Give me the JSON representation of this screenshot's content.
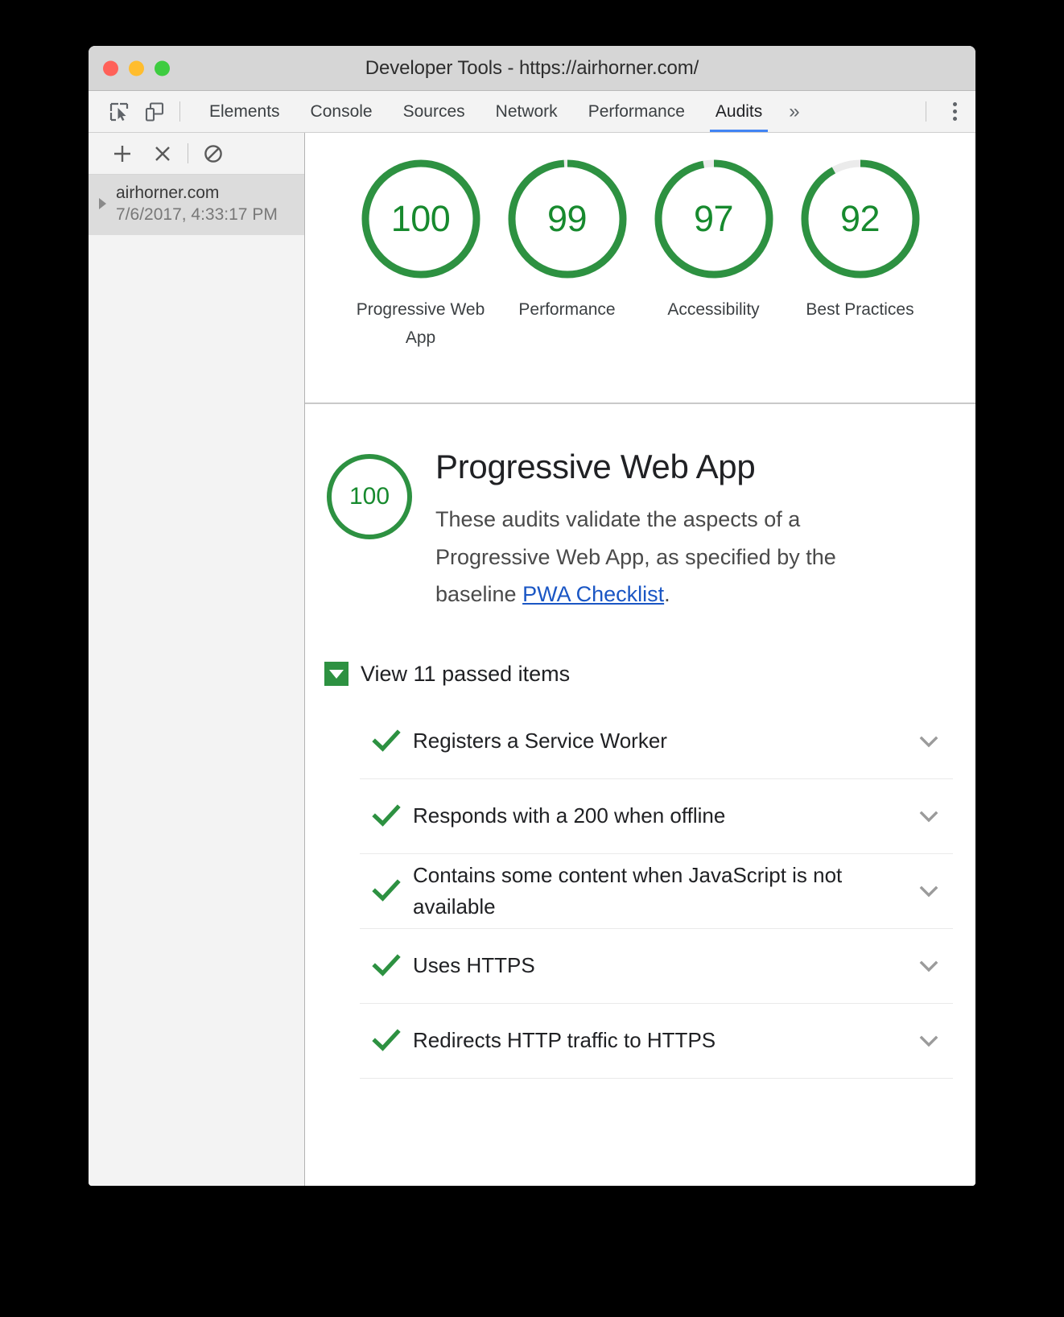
{
  "window": {
    "title": "Developer Tools - https://airhorner.com/",
    "traffic_lights": [
      "close-red",
      "minimize-yellow",
      "zoom-green"
    ]
  },
  "toolbar": {
    "inspect_icon": "inspect-element-icon",
    "device_icon": "device-toolbar-icon",
    "menu_icon": "kebab-menu-icon",
    "tabs": [
      {
        "label": "Elements",
        "active": false
      },
      {
        "label": "Console",
        "active": false
      },
      {
        "label": "Sources",
        "active": false
      },
      {
        "label": "Network",
        "active": false
      },
      {
        "label": "Performance",
        "active": false
      },
      {
        "label": "Audits",
        "active": true
      }
    ],
    "more_tabs_label": "»"
  },
  "sidebar": {
    "actions": [
      {
        "name": "add-audit-button",
        "glyph": "+"
      },
      {
        "name": "clear-audit-button",
        "glyph": "×"
      },
      {
        "name": "block-requests-button",
        "glyph": "⊘"
      }
    ],
    "report": {
      "host": "airhorner.com",
      "timestamp": "7/6/2017, 4:33:17 PM",
      "expanded": false
    }
  },
  "scores": {
    "accent_green": "#2d9141",
    "track_gray": "#ebebeb",
    "items": [
      {
        "value": "100",
        "score": 100,
        "label": "Progressive Web App"
      },
      {
        "value": "99",
        "score": 99,
        "label": "Performance"
      },
      {
        "value": "97",
        "score": 97,
        "label": "Accessibility"
      },
      {
        "value": "92",
        "score": 92,
        "label": "Best Practices"
      }
    ]
  },
  "category": {
    "score": "100",
    "score_value": 100,
    "title": "Progressive Web App",
    "description_before": "These audits validate the aspects of a Progressive Web App, as specified by the baseline ",
    "link_text": "PWA Checklist",
    "description_after": ".",
    "link_color": "#1a56c4"
  },
  "passed_section": {
    "toggle_label": "View 11 passed items",
    "expanded": true,
    "toggle_icon": "triangle-down-icon",
    "count": 11
  },
  "audits": [
    {
      "name": "Registers a Service Worker",
      "status": "pass"
    },
    {
      "name": "Responds with a 200 when offline",
      "status": "pass"
    },
    {
      "name": "Contains some content when JavaScript is not available",
      "status": "pass"
    },
    {
      "name": "Uses HTTPS",
      "status": "pass"
    },
    {
      "name": "Redirects HTTP traffic to HTTPS",
      "status": "pass"
    }
  ]
}
